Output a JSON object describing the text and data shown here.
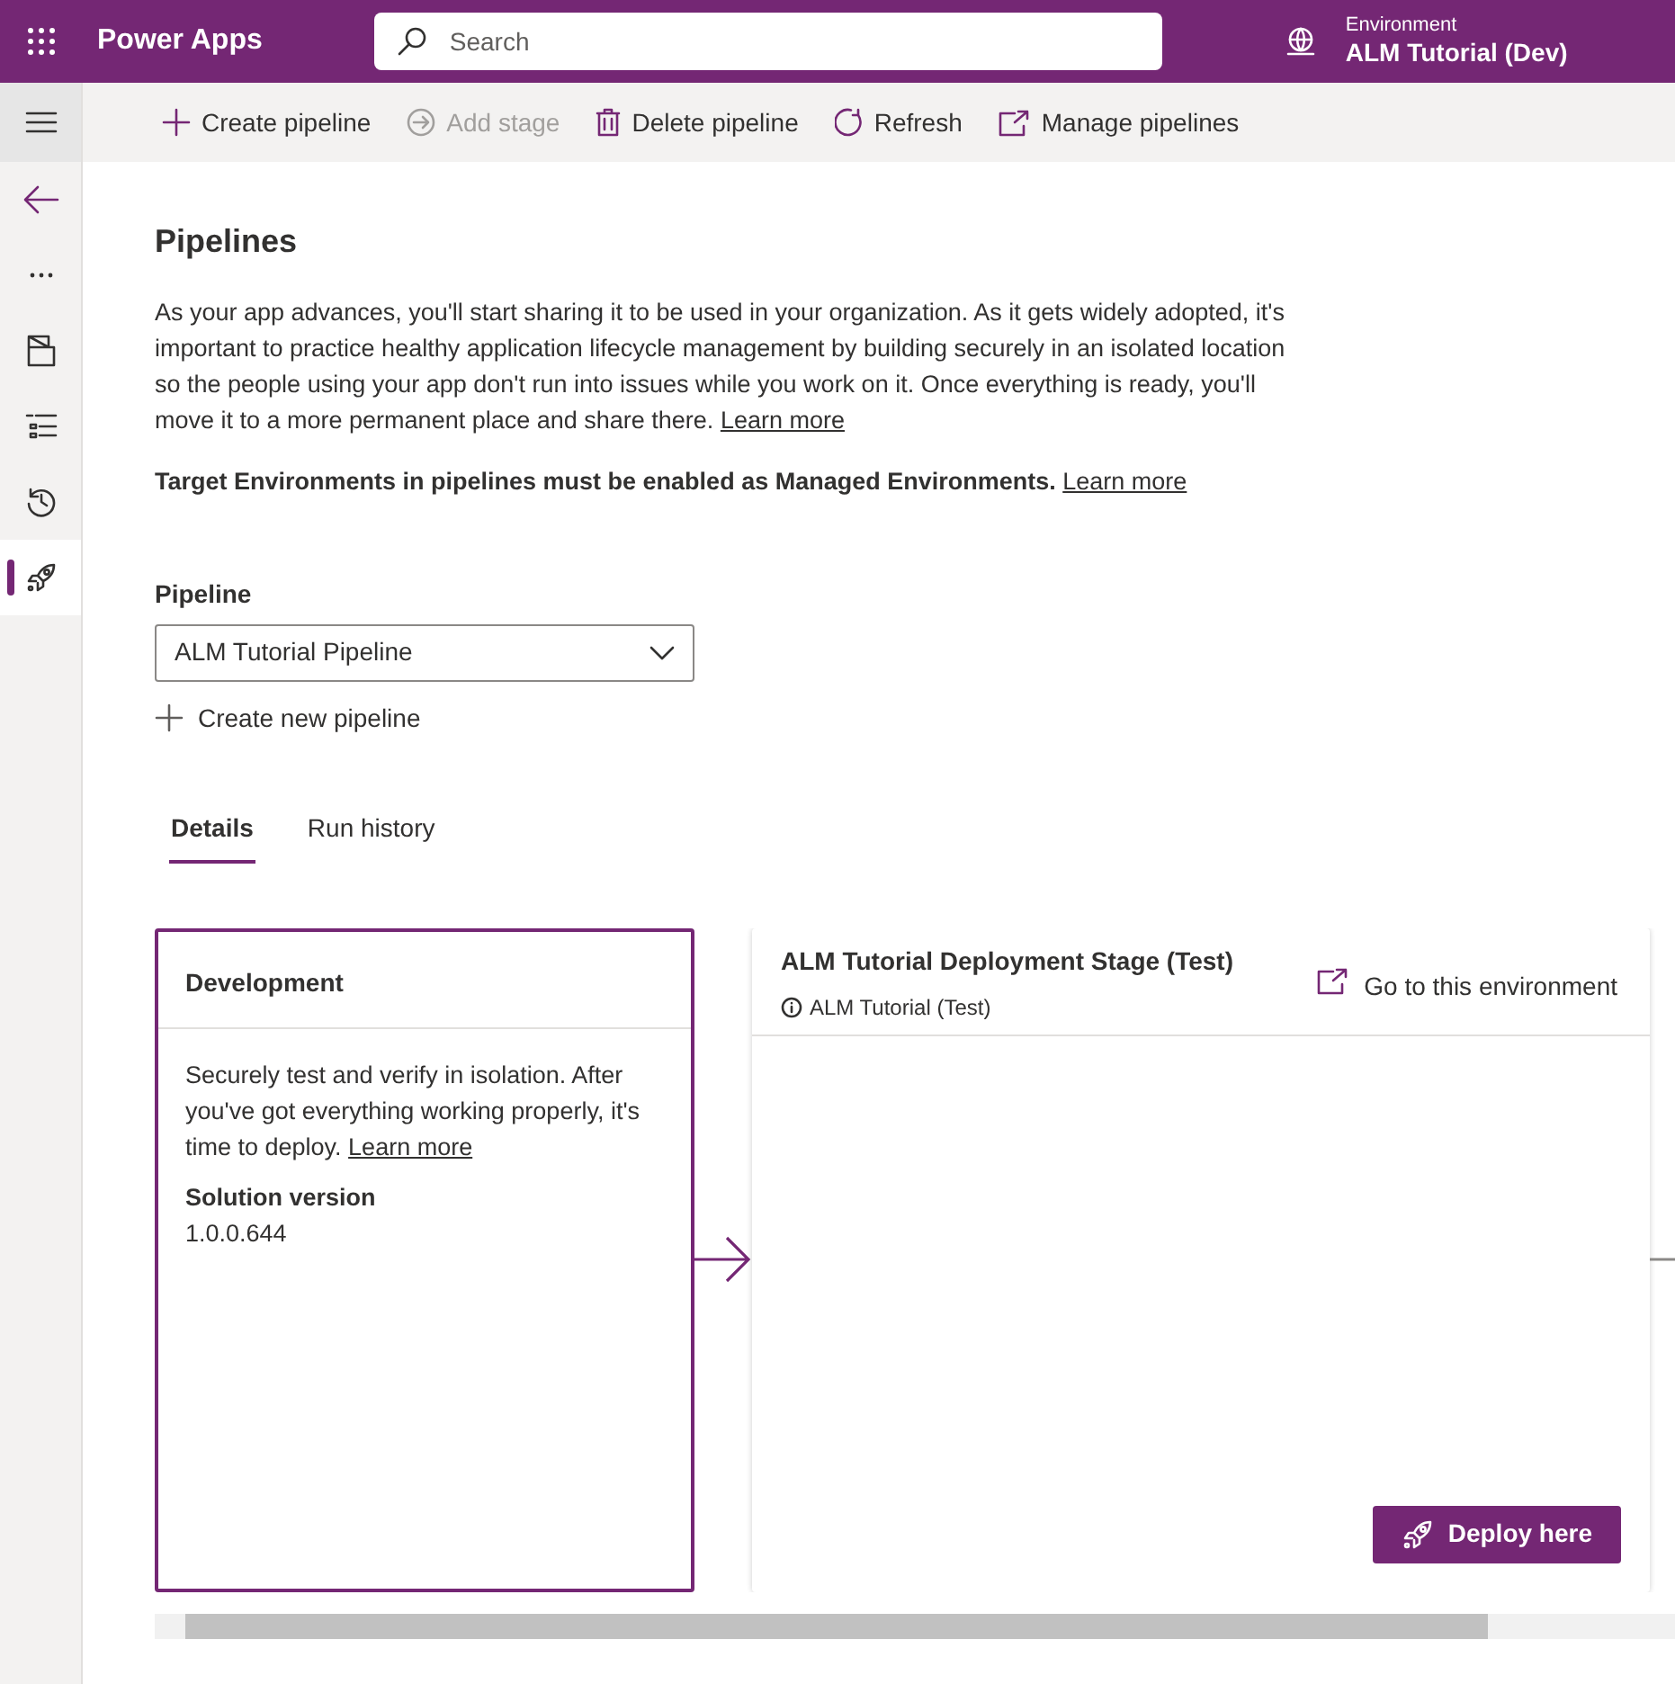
{
  "header": {
    "app_title": "Power Apps",
    "search": {
      "placeholder": "Search"
    },
    "environment": {
      "label": "Environment",
      "name": "ALM Tutorial (Dev)"
    }
  },
  "sidebar": {
    "items": [
      {
        "kind": "menu",
        "selected": false
      },
      {
        "kind": "back",
        "selected": false
      },
      {
        "kind": "more",
        "selected": false
      },
      {
        "kind": "app",
        "selected": false
      },
      {
        "kind": "list",
        "selected": false
      },
      {
        "kind": "history",
        "selected": false
      },
      {
        "kind": "rocket",
        "selected": true
      }
    ]
  },
  "toolbar": [
    {
      "kind": "add",
      "label": "Create pipeline",
      "disabled": false
    },
    {
      "kind": "stage",
      "label": "Add stage",
      "disabled": true
    },
    {
      "kind": "delete",
      "label": "Delete pipeline",
      "disabled": false
    },
    {
      "kind": "refresh",
      "label": "Refresh",
      "disabled": false
    },
    {
      "kind": "open",
      "label": "Manage pipelines",
      "disabled": false
    }
  ],
  "page": {
    "title": "Pipelines",
    "description": "As your app advances, you'll start sharing it to be used in your organization. As it gets widely adopted, it's important to practice healthy application lifecycle management by building securely in an isolated location so the people using your app don't run into issues while you work on it. Once everything is ready, you'll move it to a more permanent place and share there.",
    "description_link": "Learn more",
    "notice": "Target Environments in pipelines must be enabled as Managed Environments.",
    "notice_link": "Learn more",
    "pipeline_field": {
      "label": "Pipeline",
      "value": "ALM Tutorial Pipeline"
    },
    "create_new": "Create new pipeline"
  },
  "tabs": [
    {
      "label": "Details",
      "selected": true
    },
    {
      "label": "Run history",
      "selected": false
    }
  ],
  "stages": [
    {
      "kind": "source",
      "title": "Development",
      "description": "Securely test and verify in isolation. After you've got everything working properly, it's time to deploy.",
      "link": "Learn more",
      "version_label": "Solution version",
      "version": "1.0.0.644"
    },
    {
      "kind": "target",
      "title": "ALM Tutorial Deployment Stage (Test)",
      "environment": "ALM Tutorial (Test)",
      "link": "Go to this environment",
      "action": "Deploy here"
    }
  ]
}
